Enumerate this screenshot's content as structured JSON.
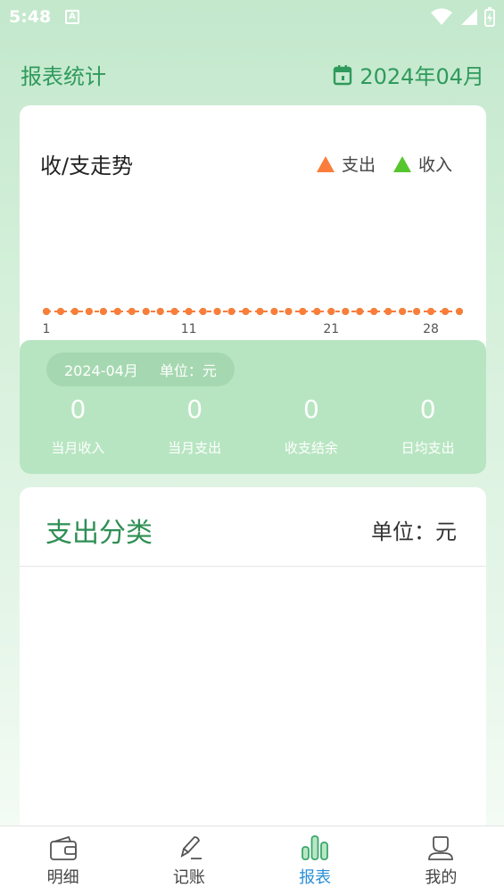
{
  "status": {
    "time": "5:48"
  },
  "header": {
    "title": "报表统计",
    "date": "2024年04月"
  },
  "trend": {
    "title": "收/支走势",
    "legend": [
      {
        "label": "支出",
        "color": "#fb7d3c"
      },
      {
        "label": "收入",
        "color": "#56c62e"
      }
    ]
  },
  "chart_data": {
    "type": "line",
    "x": [
      1,
      2,
      3,
      4,
      5,
      6,
      7,
      8,
      9,
      10,
      11,
      12,
      13,
      14,
      15,
      16,
      17,
      18,
      19,
      20,
      21,
      22,
      23,
      24,
      25,
      26,
      27,
      28,
      29,
      30
    ],
    "tick_labels": [
      "1",
      "11",
      "21",
      "28"
    ],
    "series": [
      {
        "name": "支出",
        "color": "#fb7d3c",
        "values": [
          0,
          0,
          0,
          0,
          0,
          0,
          0,
          0,
          0,
          0,
          0,
          0,
          0,
          0,
          0,
          0,
          0,
          0,
          0,
          0,
          0,
          0,
          0,
          0,
          0,
          0,
          0,
          0,
          0,
          0
        ]
      },
      {
        "name": "收入",
        "color": "#56c62e",
        "values": [
          0,
          0,
          0,
          0,
          0,
          0,
          0,
          0,
          0,
          0,
          0,
          0,
          0,
          0,
          0,
          0,
          0,
          0,
          0,
          0,
          0,
          0,
          0,
          0,
          0,
          0,
          0,
          0,
          0,
          0
        ]
      }
    ]
  },
  "summary": {
    "month": "2024-04月",
    "unit": "单位：元",
    "stats": [
      {
        "value": "0",
        "label": "当月收入"
      },
      {
        "value": "0",
        "label": "当月支出"
      },
      {
        "value": "0",
        "label": "收支结余"
      },
      {
        "value": "0",
        "label": "日均支出"
      }
    ]
  },
  "category": {
    "title": "支出分类",
    "unit": "单位：元"
  },
  "nav": {
    "items": [
      {
        "label": "明细",
        "icon": "wallet-icon"
      },
      {
        "label": "记账",
        "icon": "pencil-icon"
      },
      {
        "label": "报表",
        "icon": "bar-chart-icon"
      },
      {
        "label": "我的",
        "icon": "user-icon"
      }
    ]
  }
}
